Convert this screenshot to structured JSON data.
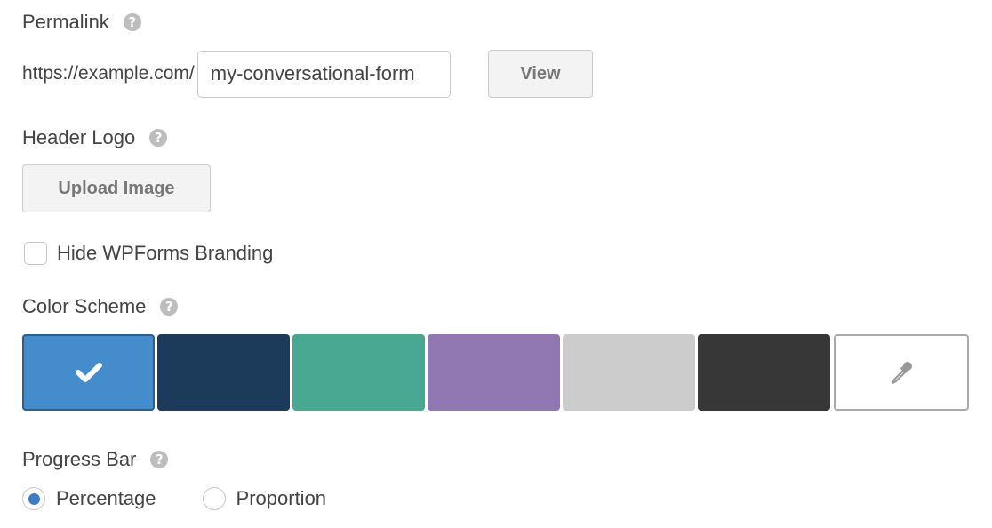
{
  "permalink": {
    "label": "Permalink",
    "help_icon": "question-circle-icon",
    "url_prefix": "https://example.com/",
    "slug_value": "my-conversational-form",
    "view_button": "View"
  },
  "header_logo": {
    "label": "Header Logo",
    "help_icon": "question-circle-icon",
    "upload_button": "Upload Image"
  },
  "branding": {
    "label": "Hide WPForms Branding",
    "checked": false
  },
  "color_scheme": {
    "label": "Color Scheme",
    "help_icon": "question-circle-icon",
    "swatches": [
      {
        "name": "blue",
        "color": "#448ccb",
        "selected": true
      },
      {
        "name": "navy",
        "color": "#1c3a5a",
        "selected": false
      },
      {
        "name": "teal",
        "color": "#48a892",
        "selected": false
      },
      {
        "name": "purple",
        "color": "#9278b2",
        "selected": false
      },
      {
        "name": "light-gray",
        "color": "#cccccc",
        "selected": false
      },
      {
        "name": "charcoal",
        "color": "#373737",
        "selected": false
      }
    ],
    "custom_icon": "eyedropper-icon",
    "check_icon": "checkmark-icon"
  },
  "progress_bar": {
    "label": "Progress Bar",
    "help_icon": "question-circle-icon",
    "options": [
      {
        "label": "Percentage",
        "selected": true
      },
      {
        "label": "Proportion",
        "selected": false
      }
    ]
  }
}
